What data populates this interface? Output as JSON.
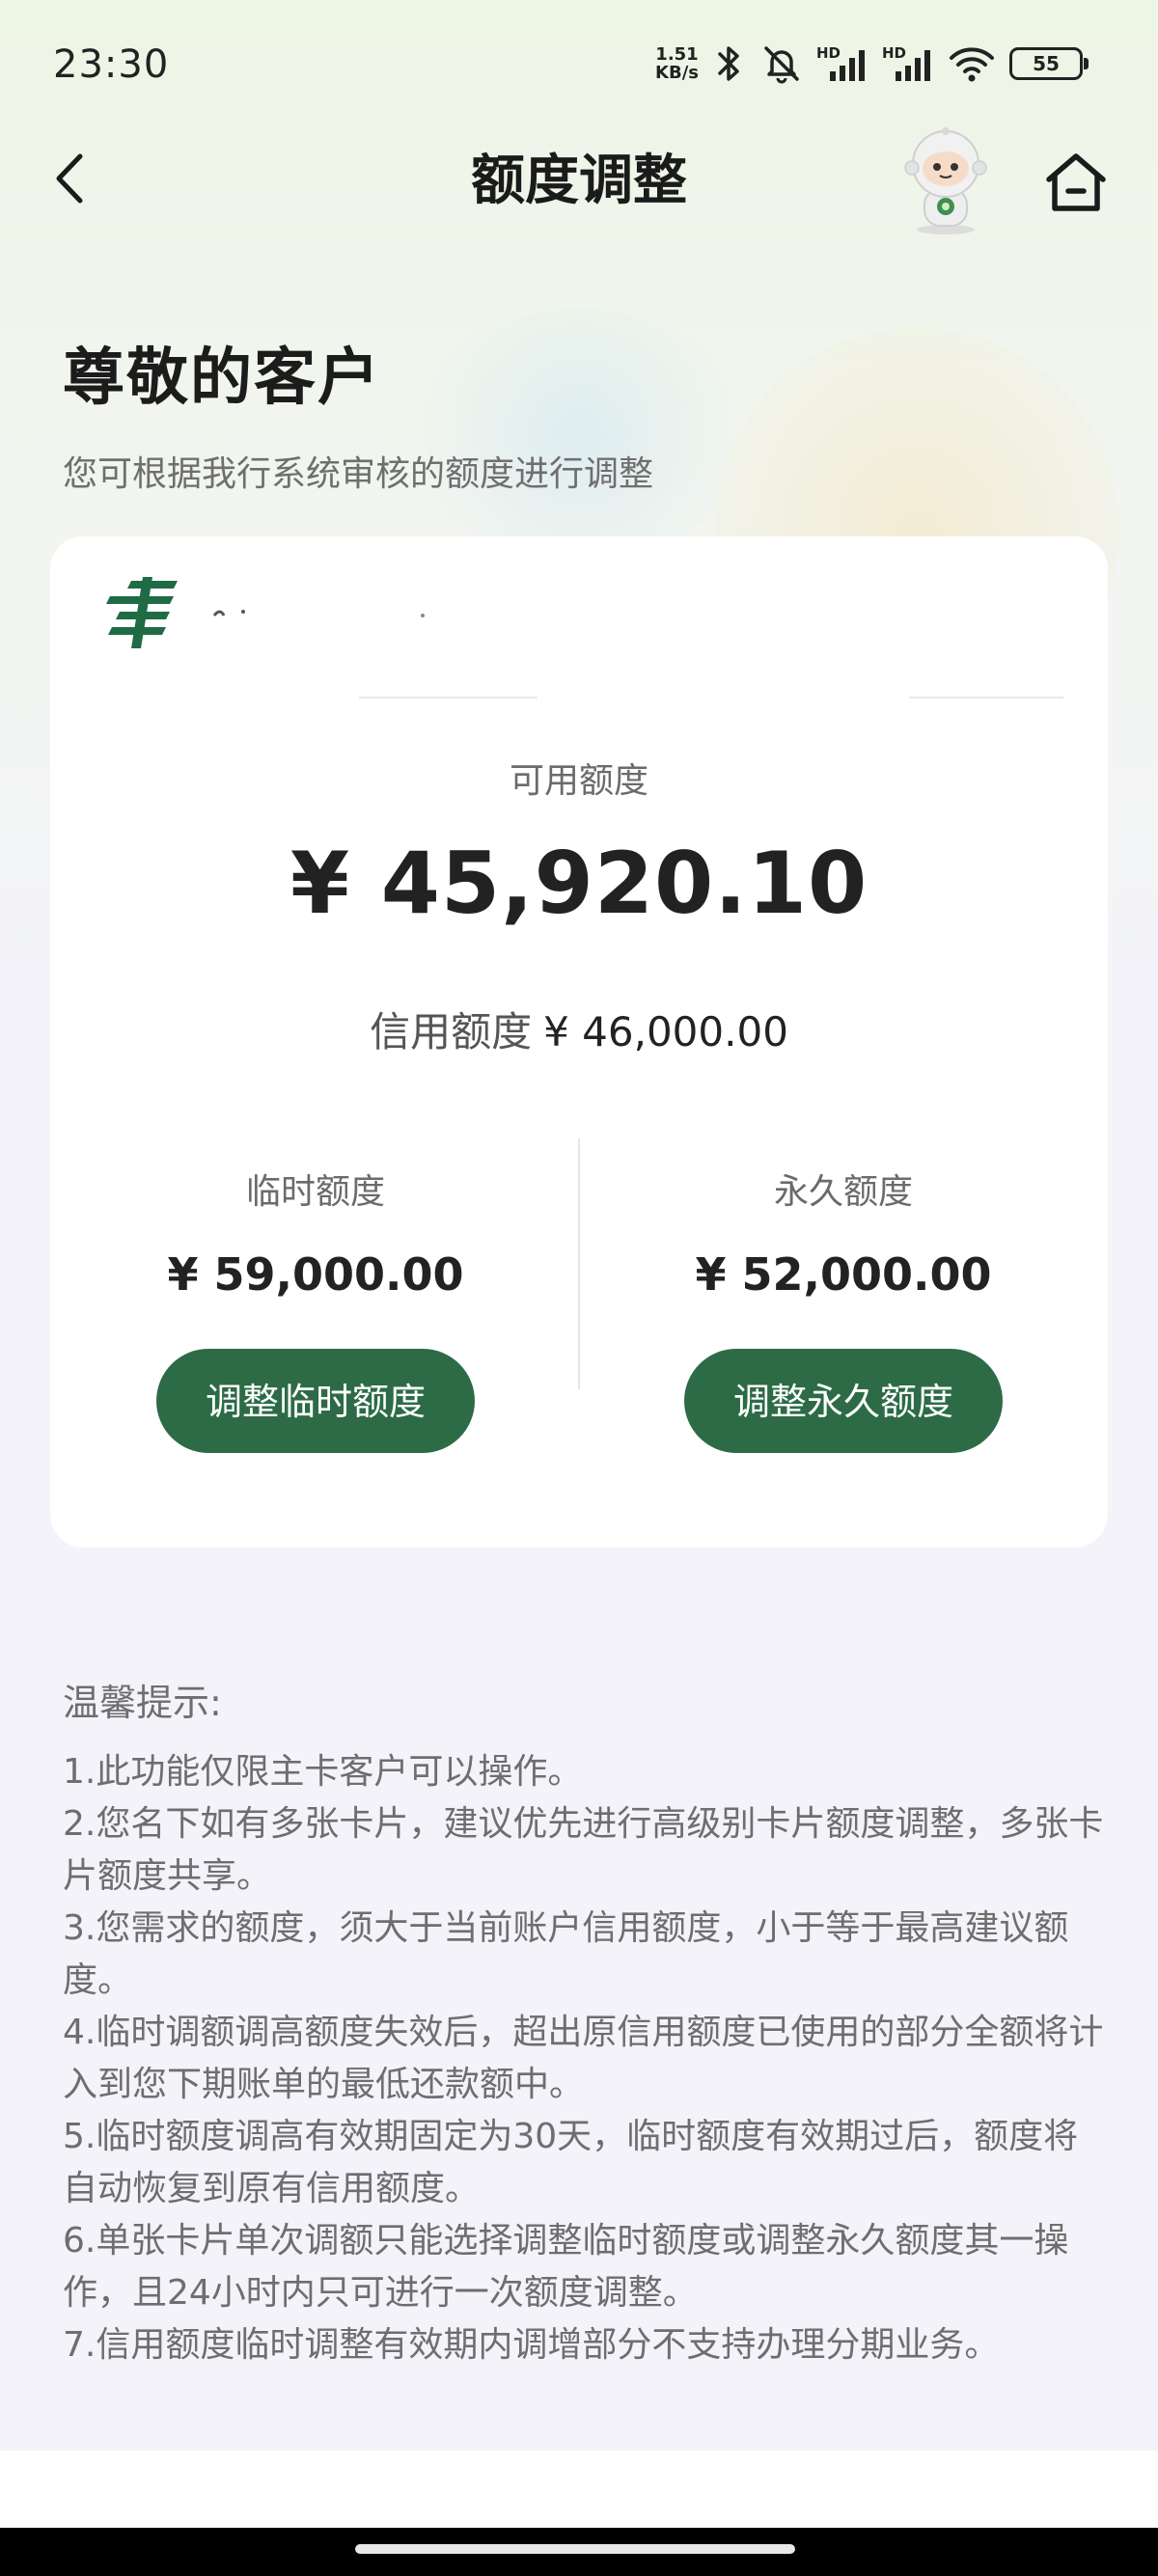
{
  "status_bar": {
    "time": "23:30",
    "net_speed_value": "1.51",
    "net_speed_unit": "KB/s",
    "signal_label_1": "HD",
    "signal_label_2": "HD",
    "battery": "55"
  },
  "nav": {
    "title": "额度调整",
    "back_icon": "chevron-left-icon",
    "mascot_icon": "robot-mascot-icon",
    "home_icon": "home-icon"
  },
  "greeting": {
    "title": "尊敬的客户",
    "subtitle": "您可根据我行系统审核的额度进行调整"
  },
  "card": {
    "available_label": "可用额度",
    "available_value": "¥ 45,920.10",
    "credit_label": "信用额度",
    "credit_value": "¥ 46,000.00",
    "temporary": {
      "label": "临时额度",
      "value": "¥ 59,000.00",
      "button": "调整临时额度"
    },
    "permanent": {
      "label": "永久额度",
      "value": "¥ 52,000.00",
      "button": "调整永久额度"
    },
    "colors": {
      "button": "#2c6b46",
      "logo": "#1f6b45"
    }
  },
  "tips": {
    "title": "温馨提示:",
    "items": [
      "1.此功能仅限主卡客户可以操作。",
      "2.您名下如有多张卡片，建议优先进行高级别卡片额度调整，多张卡片额度共享。",
      "3.您需求的额度，须大于当前账户信用额度，小于等于最高建议额度。",
      "4.临时调额调高额度失效后，超出原信用额度已使用的部分全额将计入到您下期账单的最低还款额中。",
      "5.临时额度调高有效期固定为30天，临时额度有效期过后，额度将自动恢复到原有信用额度。",
      "6.单张卡片单次调额只能选择调整临时额度或调整永久额度其一操作，且24小时内只可进行一次额度调整。",
      "7.信用额度临时调整有效期内调增部分不支持办理分期业务。"
    ]
  }
}
